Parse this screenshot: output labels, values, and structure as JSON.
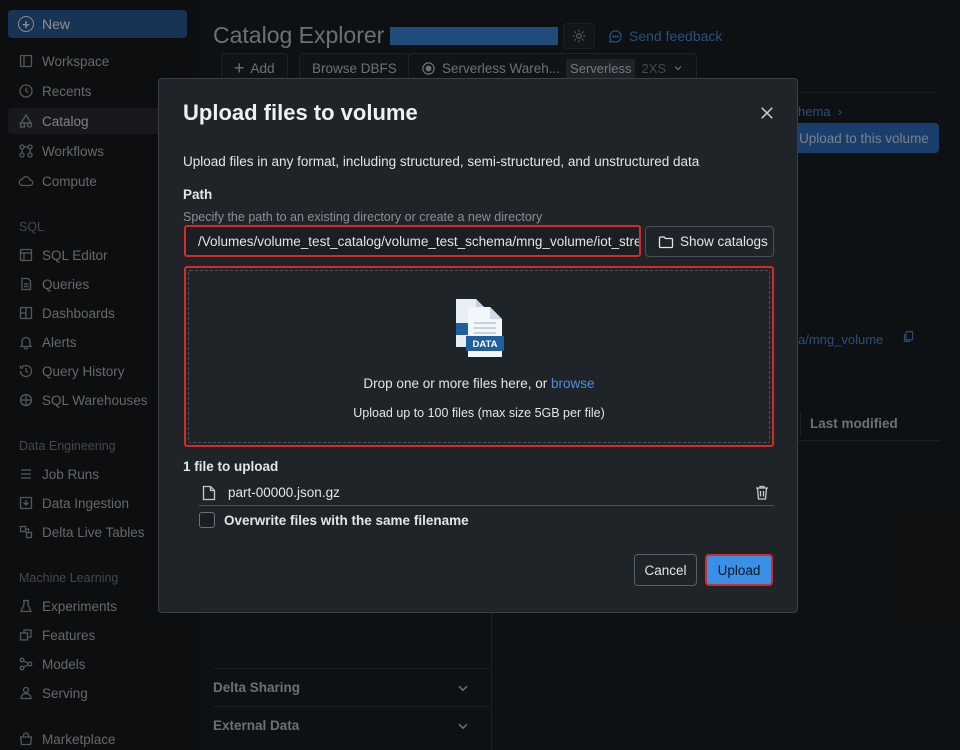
{
  "sidebar": {
    "new_label": "New",
    "items_top": [
      {
        "label": "Workspace",
        "icon": "workspace-icon"
      },
      {
        "label": "Recents",
        "icon": "clock-icon"
      },
      {
        "label": "Catalog",
        "icon": "catalog-icon",
        "active": true
      },
      {
        "label": "Workflows",
        "icon": "workflows-icon"
      },
      {
        "label": "Compute",
        "icon": "cloud-icon"
      }
    ],
    "sql_section": "SQL",
    "items_sql": [
      {
        "label": "SQL Editor",
        "icon": "sql-editor-icon"
      },
      {
        "label": "Queries",
        "icon": "queries-icon"
      },
      {
        "label": "Dashboards",
        "icon": "dashboards-icon"
      },
      {
        "label": "Alerts",
        "icon": "bell-icon"
      },
      {
        "label": "Query History",
        "icon": "history-icon"
      },
      {
        "label": "SQL Warehouses",
        "icon": "warehouse-icon"
      }
    ],
    "de_section": "Data Engineering",
    "items_de": [
      {
        "label": "Job Runs",
        "icon": "job-runs-icon"
      },
      {
        "label": "Data Ingestion",
        "icon": "ingestion-icon"
      },
      {
        "label": "Delta Live Tables",
        "icon": "dlt-icon"
      }
    ],
    "ml_section": "Machine Learning",
    "items_ml": [
      {
        "label": "Experiments",
        "icon": "flask-icon"
      },
      {
        "label": "Features",
        "icon": "features-icon"
      },
      {
        "label": "Models",
        "icon": "models-icon"
      },
      {
        "label": "Serving",
        "icon": "serving-icon"
      }
    ],
    "marketplace": "Marketplace"
  },
  "header": {
    "title": "Catalog Explorer",
    "feedback": "Send feedback",
    "add_label": "Add",
    "browse_dbfs": "Browse DBFS",
    "warehouse_name": "Serverless Wareh...",
    "warehouse_tag": "Serverless",
    "warehouse_size": "2XS"
  },
  "background": {
    "breadcrumb": "hema",
    "upload_to_volume": "Upload to this volume",
    "path_link": "a/mng_volume",
    "col_last_modified": "Last modified",
    "delta_sharing": "Delta Sharing",
    "external_data": "External Data"
  },
  "modal": {
    "title": "Upload files to volume",
    "description": "Upload files in any format, including structured, semi-structured, and unstructured data",
    "path_label": "Path",
    "path_hint": "Specify the path to an existing directory or create a new directory",
    "path_value": "/Volumes/volume_test_catalog/volume_test_schema/mng_volume/iot_strea",
    "show_catalogs": "Show catalogs",
    "illustration_label": "DATA",
    "drop_text": "Drop one or more files here, or",
    "browse": "browse",
    "drop_limit": "Upload up to 100 files (max size 5GB per file)",
    "files_count": "1 file to upload",
    "files": [
      {
        "name": "part-00000.json.gz"
      }
    ],
    "overwrite_label": "Overwrite files with the same filename",
    "cancel": "Cancel",
    "upload": "Upload"
  },
  "colors": {
    "accent": "#3a8fe6",
    "highlight": "#d42a2a",
    "link": "#4f8fdb"
  }
}
